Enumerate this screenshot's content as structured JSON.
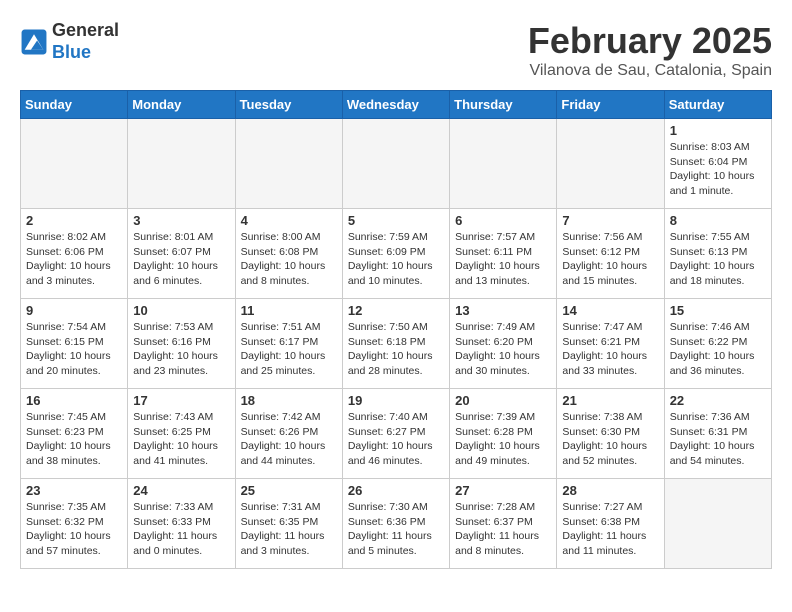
{
  "header": {
    "logo_line1": "General",
    "logo_line2": "Blue",
    "title": "February 2025",
    "subtitle": "Vilanova de Sau, Catalonia, Spain"
  },
  "weekdays": [
    "Sunday",
    "Monday",
    "Tuesday",
    "Wednesday",
    "Thursday",
    "Friday",
    "Saturday"
  ],
  "weeks": [
    [
      {
        "day": "",
        "info": ""
      },
      {
        "day": "",
        "info": ""
      },
      {
        "day": "",
        "info": ""
      },
      {
        "day": "",
        "info": ""
      },
      {
        "day": "",
        "info": ""
      },
      {
        "day": "",
        "info": ""
      },
      {
        "day": "1",
        "info": "Sunrise: 8:03 AM\nSunset: 6:04 PM\nDaylight: 10 hours\nand 1 minute."
      }
    ],
    [
      {
        "day": "2",
        "info": "Sunrise: 8:02 AM\nSunset: 6:06 PM\nDaylight: 10 hours\nand 3 minutes."
      },
      {
        "day": "3",
        "info": "Sunrise: 8:01 AM\nSunset: 6:07 PM\nDaylight: 10 hours\nand 6 minutes."
      },
      {
        "day": "4",
        "info": "Sunrise: 8:00 AM\nSunset: 6:08 PM\nDaylight: 10 hours\nand 8 minutes."
      },
      {
        "day": "5",
        "info": "Sunrise: 7:59 AM\nSunset: 6:09 PM\nDaylight: 10 hours\nand 10 minutes."
      },
      {
        "day": "6",
        "info": "Sunrise: 7:57 AM\nSunset: 6:11 PM\nDaylight: 10 hours\nand 13 minutes."
      },
      {
        "day": "7",
        "info": "Sunrise: 7:56 AM\nSunset: 6:12 PM\nDaylight: 10 hours\nand 15 minutes."
      },
      {
        "day": "8",
        "info": "Sunrise: 7:55 AM\nSunset: 6:13 PM\nDaylight: 10 hours\nand 18 minutes."
      }
    ],
    [
      {
        "day": "9",
        "info": "Sunrise: 7:54 AM\nSunset: 6:15 PM\nDaylight: 10 hours\nand 20 minutes."
      },
      {
        "day": "10",
        "info": "Sunrise: 7:53 AM\nSunset: 6:16 PM\nDaylight: 10 hours\nand 23 minutes."
      },
      {
        "day": "11",
        "info": "Sunrise: 7:51 AM\nSunset: 6:17 PM\nDaylight: 10 hours\nand 25 minutes."
      },
      {
        "day": "12",
        "info": "Sunrise: 7:50 AM\nSunset: 6:18 PM\nDaylight: 10 hours\nand 28 minutes."
      },
      {
        "day": "13",
        "info": "Sunrise: 7:49 AM\nSunset: 6:20 PM\nDaylight: 10 hours\nand 30 minutes."
      },
      {
        "day": "14",
        "info": "Sunrise: 7:47 AM\nSunset: 6:21 PM\nDaylight: 10 hours\nand 33 minutes."
      },
      {
        "day": "15",
        "info": "Sunrise: 7:46 AM\nSunset: 6:22 PM\nDaylight: 10 hours\nand 36 minutes."
      }
    ],
    [
      {
        "day": "16",
        "info": "Sunrise: 7:45 AM\nSunset: 6:23 PM\nDaylight: 10 hours\nand 38 minutes."
      },
      {
        "day": "17",
        "info": "Sunrise: 7:43 AM\nSunset: 6:25 PM\nDaylight: 10 hours\nand 41 minutes."
      },
      {
        "day": "18",
        "info": "Sunrise: 7:42 AM\nSunset: 6:26 PM\nDaylight: 10 hours\nand 44 minutes."
      },
      {
        "day": "19",
        "info": "Sunrise: 7:40 AM\nSunset: 6:27 PM\nDaylight: 10 hours\nand 46 minutes."
      },
      {
        "day": "20",
        "info": "Sunrise: 7:39 AM\nSunset: 6:28 PM\nDaylight: 10 hours\nand 49 minutes."
      },
      {
        "day": "21",
        "info": "Sunrise: 7:38 AM\nSunset: 6:30 PM\nDaylight: 10 hours\nand 52 minutes."
      },
      {
        "day": "22",
        "info": "Sunrise: 7:36 AM\nSunset: 6:31 PM\nDaylight: 10 hours\nand 54 minutes."
      }
    ],
    [
      {
        "day": "23",
        "info": "Sunrise: 7:35 AM\nSunset: 6:32 PM\nDaylight: 10 hours\nand 57 minutes."
      },
      {
        "day": "24",
        "info": "Sunrise: 7:33 AM\nSunset: 6:33 PM\nDaylight: 11 hours\nand 0 minutes."
      },
      {
        "day": "25",
        "info": "Sunrise: 7:31 AM\nSunset: 6:35 PM\nDaylight: 11 hours\nand 3 minutes."
      },
      {
        "day": "26",
        "info": "Sunrise: 7:30 AM\nSunset: 6:36 PM\nDaylight: 11 hours\nand 5 minutes."
      },
      {
        "day": "27",
        "info": "Sunrise: 7:28 AM\nSunset: 6:37 PM\nDaylight: 11 hours\nand 8 minutes."
      },
      {
        "day": "28",
        "info": "Sunrise: 7:27 AM\nSunset: 6:38 PM\nDaylight: 11 hours\nand 11 minutes."
      },
      {
        "day": "",
        "info": ""
      }
    ]
  ]
}
